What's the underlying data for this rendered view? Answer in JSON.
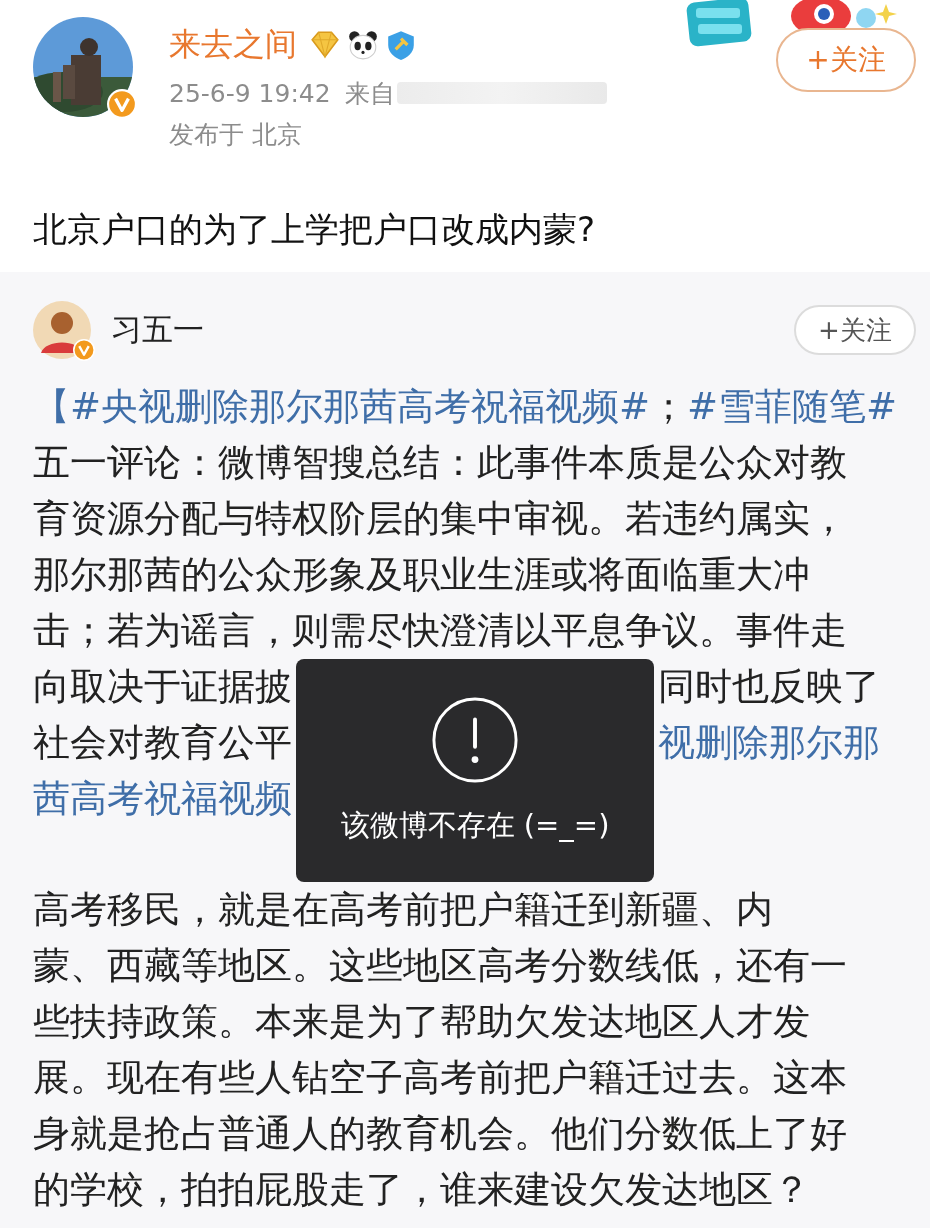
{
  "post": {
    "author": "来去之间",
    "follow": "+关注",
    "time": "25-6-9 19:42",
    "source": "来自",
    "location": "发布于 北京",
    "text": "北京户口的为了上学把户口改成内蒙?"
  },
  "repost": {
    "author": "习五一",
    "follow": "+关注",
    "paragraphs": [
      {
        "lines": [
          {
            "left": [
              {
                "text": "【#央视删除那尔那茜高考祝福视频#",
                "kind": "link"
              },
              {
                "text": "；",
                "kind": "plain"
              },
              {
                "text": "#雪菲随笔#",
                "kind": "link"
              }
            ]
          },
          {
            "left": [
              {
                "text": "五一评论：微博智搜总结：此事件本质是公众对教",
                "kind": "plain"
              }
            ]
          },
          {
            "left": [
              {
                "text": "育资源分配与特权阶层的集中审视。若违约属实，",
                "kind": "plain"
              }
            ]
          },
          {
            "left": [
              {
                "text": "那尔那茜的公众形象及职业生涯或将面临重大冲",
                "kind": "plain"
              }
            ]
          },
          {
            "left": [
              {
                "text": "击；若为谣言，则需尽快澄清以平息争议。事件走",
                "kind": "plain"
              }
            ]
          },
          {
            "left": [
              {
                "text": "向取决于证据披",
                "kind": "plain"
              }
            ],
            "right": [
              {
                "text": "同时也反映了",
                "kind": "plain"
              }
            ]
          },
          {
            "left": [
              {
                "text": "社会对教育公平",
                "kind": "plain"
              }
            ],
            "right": [
              {
                "text": "视删除那尔那",
                "kind": "link"
              }
            ]
          },
          {
            "left": [
              {
                "text": "茜高考祝福视频",
                "kind": "link"
              }
            ]
          }
        ]
      },
      {
        "lines": [
          {
            "left": [
              {
                "text": "高考移民，就是在高考前把户籍迁到新疆、内",
                "kind": "plain"
              }
            ]
          },
          {
            "left": [
              {
                "text": "蒙、西藏等地区。这些地区高考分数线低，还有一",
                "kind": "plain"
              }
            ]
          },
          {
            "left": [
              {
                "text": "些扶持政策。本来是为了帮助欠发达地区人才发",
                "kind": "plain"
              }
            ]
          },
          {
            "left": [
              {
                "text": "展。现在有些人钻空子高考前把户籍迁过去。这本",
                "kind": "plain"
              }
            ]
          },
          {
            "left": [
              {
                "text": "身就是抢占普通人的教育机会。他们分数低上了好",
                "kind": "plain"
              }
            ]
          },
          {
            "left": [
              {
                "text": "的学校，拍拍屁股走了，谁来建设欠发达地区？",
                "kind": "plain"
              }
            ]
          }
        ]
      }
    ]
  },
  "toast": {
    "message": "该微博不存在 (=_=)"
  }
}
